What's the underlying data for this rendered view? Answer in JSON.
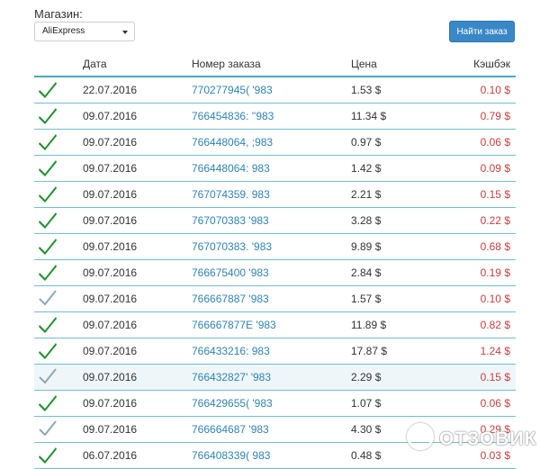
{
  "shop": {
    "label": "Магазин:",
    "selected": "AliExpress"
  },
  "find_button": "Найти заказ",
  "columns": {
    "date": "Дата",
    "order": "Номер заказа",
    "price": "Цена",
    "cashback": "Кэшбэк"
  },
  "colors": {
    "accent": "#3a87c8",
    "link": "#2f83b6",
    "cashback": "#c9403f",
    "check_done": "#1f8f2e",
    "check_pending": "#8fa7b6"
  },
  "rows": [
    {
      "status": "done",
      "date": "22.07.2016",
      "order": "770277945(  '983",
      "price": "1.53 $",
      "cashback": "0.10 $"
    },
    {
      "status": "done",
      "date": "09.07.2016",
      "order": "766454836: ''983",
      "price": "11.34 $",
      "cashback": "0.79 $"
    },
    {
      "status": "done",
      "date": "09.07.2016",
      "order": "766448064,  ;983",
      "price": "0.97 $",
      "cashback": "0.06 $"
    },
    {
      "status": "done",
      "date": "09.07.2016",
      "order": "766448064:  983",
      "price": "1.42 $",
      "cashback": "0.09 $"
    },
    {
      "status": "done",
      "date": "09.07.2016",
      "order": "767074359.  983",
      "price": "2.21 $",
      "cashback": "0.15 $"
    },
    {
      "status": "done",
      "date": "09.07.2016",
      "order": "767070383  '983",
      "price": "3.28 $",
      "cashback": "0.22 $"
    },
    {
      "status": "done",
      "date": "09.07.2016",
      "order": "767070383.  '983",
      "price": "9.89 $",
      "cashback": "0.68 $"
    },
    {
      "status": "done",
      "date": "09.07.2016",
      "order": "766675400  '983",
      "price": "2.84 $",
      "cashback": "0.19 $"
    },
    {
      "status": "pending",
      "date": "09.07.2016",
      "order": "766667887  '983",
      "price": "1.57 $",
      "cashback": "0.10 $"
    },
    {
      "status": "done",
      "date": "09.07.2016",
      "order": "766667877E '983",
      "price": "11.89 $",
      "cashback": "0.82 $"
    },
    {
      "status": "done",
      "date": "09.07.2016",
      "order": "766433216:  983",
      "price": "17.87 $",
      "cashback": "1.24 $"
    },
    {
      "status": "pending",
      "date": "09.07.2016",
      "order": "766432827'  '983",
      "price": "2.29 $",
      "cashback": "0.15 $"
    },
    {
      "status": "done",
      "date": "09.07.2016",
      "order": "766429655(  '983",
      "price": "1.07 $",
      "cashback": "0.06 $"
    },
    {
      "status": "pending",
      "date": "09.07.2016",
      "order": "766664687  '983",
      "price": "4.30 $",
      "cashback": "0.29 $"
    },
    {
      "status": "done",
      "date": "06.07.2016",
      "order": "766408339(  983",
      "price": "0.48 $",
      "cashback": "0.03 $"
    }
  ],
  "watermark": {
    "text": "ОТЗОВИК"
  }
}
